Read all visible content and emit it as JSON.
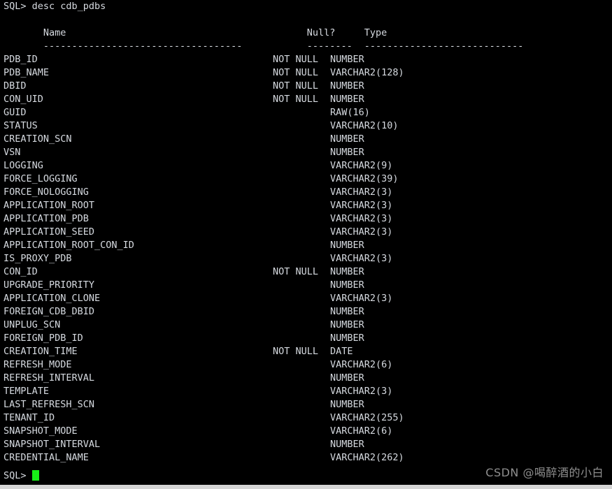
{
  "terminal": {
    "prompt": "SQL>",
    "command_line": "SQL> desc cdb_pdbs",
    "bottom_prompt": "SQL> ",
    "cursor": "block-cursor",
    "colors": {
      "background": "#000000",
      "foreground": "#d6dae0",
      "cursor": "#17f017",
      "watermark": "#8e8e8e",
      "bottom_bar": "#d5d5d5"
    }
  },
  "table": {
    "headers": {
      "name": " Name",
      "null": "Null?",
      "type": "Type"
    },
    "separator": {
      "name": " ----------------------------------- ",
      "null": "-------- ",
      "type": "----------------------------"
    },
    "rows": [
      {
        "name": "PDB_ID",
        "null": "NOT NULL",
        "type": "NUMBER"
      },
      {
        "name": "PDB_NAME",
        "null": "NOT NULL",
        "type": "VARCHAR2(128)"
      },
      {
        "name": "DBID",
        "null": "NOT NULL",
        "type": "NUMBER"
      },
      {
        "name": "CON_UID",
        "null": "NOT NULL",
        "type": "NUMBER"
      },
      {
        "name": "GUID",
        "null": "",
        "type": "RAW(16)"
      },
      {
        "name": "STATUS",
        "null": "",
        "type": "VARCHAR2(10)"
      },
      {
        "name": "CREATION_SCN",
        "null": "",
        "type": "NUMBER"
      },
      {
        "name": "VSN",
        "null": "",
        "type": "NUMBER"
      },
      {
        "name": "LOGGING",
        "null": "",
        "type": "VARCHAR2(9)"
      },
      {
        "name": "FORCE_LOGGING",
        "null": "",
        "type": "VARCHAR2(39)"
      },
      {
        "name": "FORCE_NOLOGGING",
        "null": "",
        "type": "VARCHAR2(3)"
      },
      {
        "name": "APPLICATION_ROOT",
        "null": "",
        "type": "VARCHAR2(3)"
      },
      {
        "name": "APPLICATION_PDB",
        "null": "",
        "type": "VARCHAR2(3)"
      },
      {
        "name": "APPLICATION_SEED",
        "null": "",
        "type": "VARCHAR2(3)"
      },
      {
        "name": "APPLICATION_ROOT_CON_ID",
        "null": "",
        "type": "NUMBER"
      },
      {
        "name": "IS_PROXY_PDB",
        "null": "",
        "type": "VARCHAR2(3)"
      },
      {
        "name": "CON_ID",
        "null": "NOT NULL",
        "type": "NUMBER"
      },
      {
        "name": "UPGRADE_PRIORITY",
        "null": "",
        "type": "NUMBER"
      },
      {
        "name": "APPLICATION_CLONE",
        "null": "",
        "type": "VARCHAR2(3)"
      },
      {
        "name": "FOREIGN_CDB_DBID",
        "null": "",
        "type": "NUMBER"
      },
      {
        "name": "UNPLUG_SCN",
        "null": "",
        "type": "NUMBER"
      },
      {
        "name": "FOREIGN_PDB_ID",
        "null": "",
        "type": "NUMBER"
      },
      {
        "name": "CREATION_TIME",
        "null": "NOT NULL",
        "type": "DATE"
      },
      {
        "name": "REFRESH_MODE",
        "null": "",
        "type": "VARCHAR2(6)"
      },
      {
        "name": "REFRESH_INTERVAL",
        "null": "",
        "type": "NUMBER"
      },
      {
        "name": "TEMPLATE",
        "null": "",
        "type": "VARCHAR2(3)"
      },
      {
        "name": "LAST_REFRESH_SCN",
        "null": "",
        "type": "NUMBER"
      },
      {
        "name": "TENANT_ID",
        "null": "",
        "type": "VARCHAR2(255)"
      },
      {
        "name": "SNAPSHOT_MODE",
        "null": "",
        "type": "VARCHAR2(6)"
      },
      {
        "name": "SNAPSHOT_INTERVAL",
        "null": "",
        "type": "NUMBER"
      },
      {
        "name": "CREDENTIAL_NAME",
        "null": "",
        "type": "VARCHAR2(262)"
      }
    ]
  },
  "watermark": {
    "text": "CSDN @喝醉酒的小白"
  }
}
